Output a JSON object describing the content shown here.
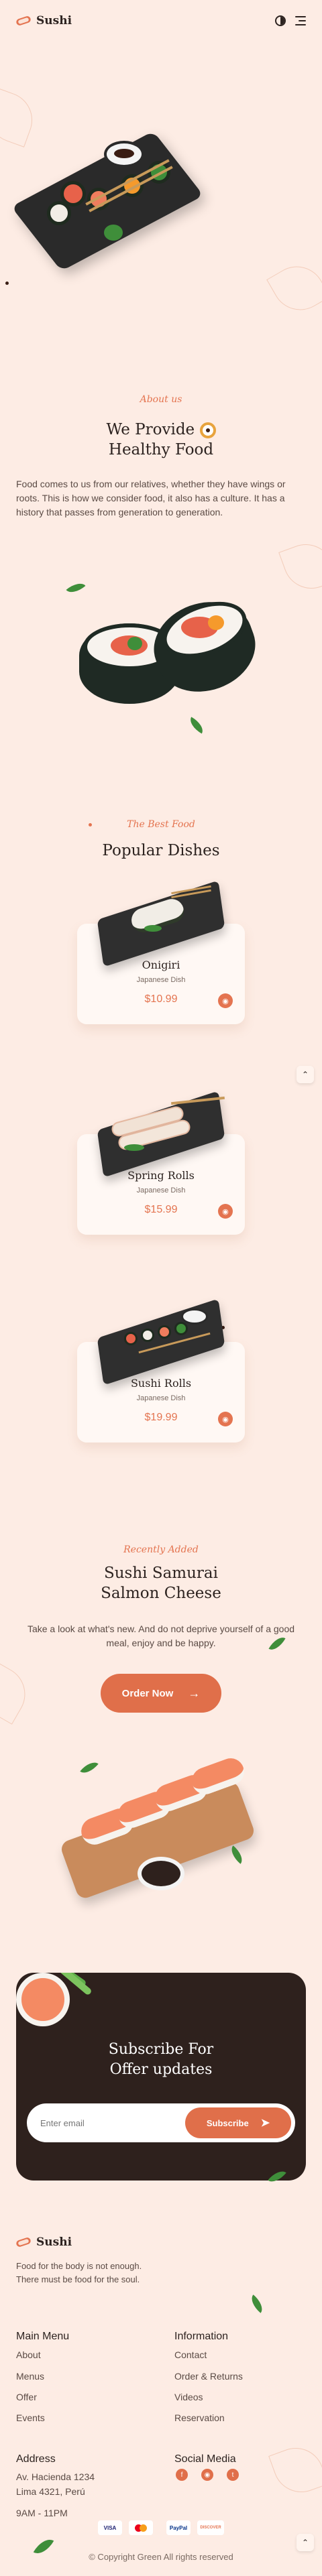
{
  "header": {
    "brand": "Sushi"
  },
  "about": {
    "subtitle": "About us",
    "title_line1": "We Provide",
    "title_line2": "Healthy Food",
    "description": "Food comes to us from our relatives, whether they have wings or roots. This is how we consider food, it also has a culture. It has a history that passes from generation to generation."
  },
  "popular": {
    "subtitle": "The Best Food",
    "title": "Popular Dishes",
    "dishes": [
      {
        "name": "Onigiri",
        "type": "Japanese Dish",
        "price": "$10.99"
      },
      {
        "name": "Spring Rolls",
        "type": "Japanese Dish",
        "price": "$15.99"
      },
      {
        "name": "Sushi Rolls",
        "type": "Japanese Dish",
        "price": "$19.99"
      }
    ]
  },
  "recent": {
    "subtitle": "Recently Added",
    "title_line1": "Sushi Samurai",
    "title_line2": "Salmon Cheese",
    "description": "Take a look at what's new. And do not deprive yourself of a good meal, enjoy and be happy.",
    "button_label": "Order Now"
  },
  "subscribe": {
    "title_line1": "Subscribe For",
    "title_line2": "Offer updates",
    "email_placeholder": "Enter email",
    "button_label": "Subscribe"
  },
  "footer": {
    "brand": "Sushi",
    "description": "Food for the body is not enough. There must be food for the soul.",
    "main_menu": {
      "title": "Main Menu",
      "links": [
        "About",
        "Menus",
        "Offer",
        "Events"
      ]
    },
    "information": {
      "title": "Information",
      "links": [
        "Contact",
        "Order & Returns",
        "Videos",
        "Reservation"
      ]
    },
    "address": {
      "title": "Address",
      "line1": "Av. Hacienda 1234",
      "line2": "Lima 4321, Perú",
      "hours": "9AM - 11PM"
    },
    "social": {
      "title": "Social Media",
      "icons": [
        "facebook-icon",
        "instagram-icon",
        "twitter-icon"
      ]
    },
    "payments": [
      "VISA",
      "mastercard",
      "PayPal",
      "DISCOVER"
    ],
    "copyright": "© Copyright Green All rights reserved"
  },
  "colors": {
    "accent": "#e06f4a",
    "background": "#fdece4",
    "dark": "#2e211d"
  }
}
